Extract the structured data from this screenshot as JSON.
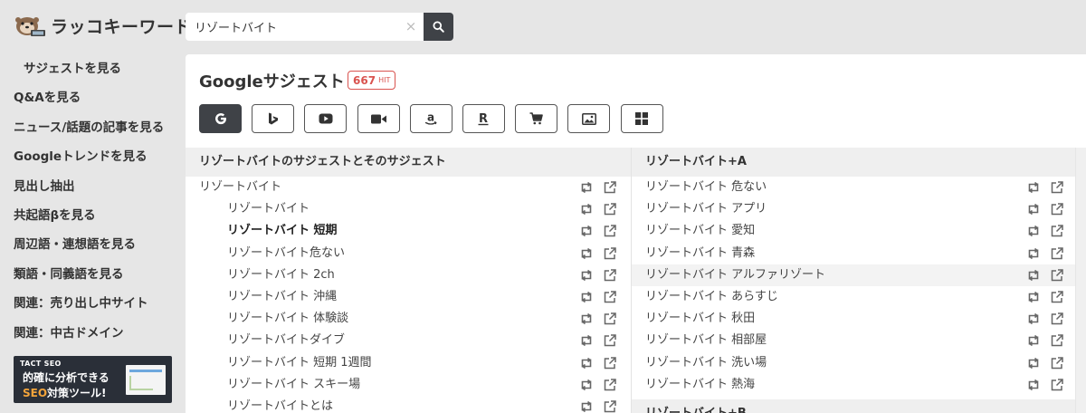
{
  "app": {
    "name": "ラッコキーワード"
  },
  "search": {
    "value": "リゾートバイト",
    "clear_glyph": "×"
  },
  "sidebar": {
    "items": [
      {
        "label": "サジェストを見る",
        "active": true
      },
      {
        "label": "Q&Aを見る"
      },
      {
        "label": "ニュース/話題の記事を見る"
      },
      {
        "label": "Googleトレンドを見る"
      },
      {
        "label": "見出し抽出"
      },
      {
        "label": "共起語βを見る"
      },
      {
        "label": "周辺語・連想語を見る"
      },
      {
        "label": "類語・同義語を見る"
      },
      {
        "label": "関連：売り出し中サイト"
      },
      {
        "label": "関連：中古ドメイン"
      }
    ],
    "banner": {
      "brand": "TACT SEO",
      "line1": "的確に分析できる",
      "line2_highlight": "SEO",
      "line2_rest": "対策ツール!"
    }
  },
  "main": {
    "title": "Googleサジェスト",
    "hit_count": "667",
    "hit_unit": "HIT",
    "engines": [
      {
        "icon": "google-icon",
        "active": true
      },
      {
        "icon": "bing-icon"
      },
      {
        "icon": "youtube-icon"
      },
      {
        "icon": "video-icon"
      },
      {
        "icon": "amazon-icon"
      },
      {
        "icon": "rakuten-icon"
      },
      {
        "icon": "cart-icon"
      },
      {
        "icon": "image-icon"
      },
      {
        "icon": "grid-icon"
      }
    ],
    "left_column": {
      "header": "リゾートバイトのサジェストとそのサジェスト",
      "rows": [
        {
          "text": "リゾートバイト",
          "level": 0
        },
        {
          "text": "リゾートバイト",
          "level": 1
        },
        {
          "text": "リゾートバイト 短期",
          "level": 1,
          "bold": true
        },
        {
          "text": "リゾートバイト危ない",
          "level": 1
        },
        {
          "text": "リゾートバイト 2ch",
          "level": 1
        },
        {
          "text": "リゾートバイト 沖縄",
          "level": 1
        },
        {
          "text": "リゾートバイト 体験談",
          "level": 1
        },
        {
          "text": "リゾートバイトダイブ",
          "level": 1
        },
        {
          "text": "リゾートバイト 短期 1週間",
          "level": 1
        },
        {
          "text": "リゾートバイト スキー場",
          "level": 1
        },
        {
          "text": "リゾートバイトとは",
          "level": 1
        }
      ]
    },
    "right_column": {
      "header": "リゾートバイト+A",
      "rows": [
        {
          "text": "リゾートバイト 危ない"
        },
        {
          "text": "リゾートバイト アプリ"
        },
        {
          "text": "リゾートバイト 愛知"
        },
        {
          "text": "リゾートバイト 青森"
        },
        {
          "text": "リゾートバイト アルファリゾート",
          "hover": true
        },
        {
          "text": "リゾートバイト あらすじ"
        },
        {
          "text": "リゾートバイト 秋田"
        },
        {
          "text": "リゾートバイト 相部屋"
        },
        {
          "text": "リゾートバイト 洗い場"
        },
        {
          "text": "リゾートバイト 熱海"
        }
      ],
      "next_header": "リゾートバイト+B"
    }
  },
  "colors": {
    "accent_dark": "#3f4247",
    "badge_red": "#d9534f",
    "banner_highlight": "#f3a43b"
  }
}
